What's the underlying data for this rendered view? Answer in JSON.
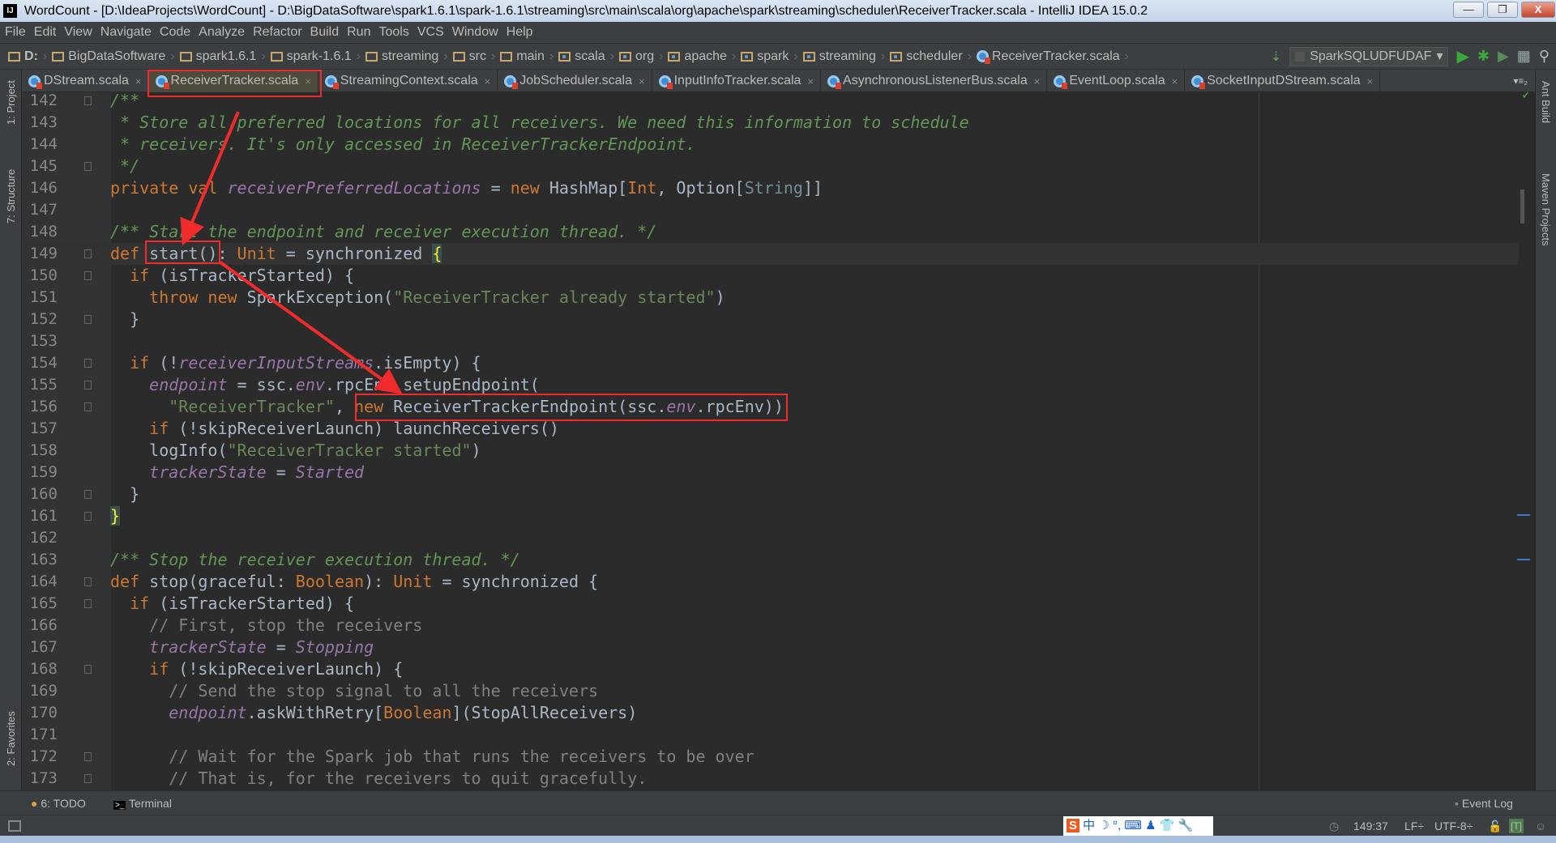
{
  "window": {
    "title": "WordCount - [D:\\IdeaProjects\\WordCount] - D:\\BigDataSoftware\\spark1.6.1\\spark-1.6.1\\streaming\\src\\main\\scala\\org\\apache\\spark\\streaming\\scheduler\\ReceiverTracker.scala - IntelliJ IDEA 15.0.2",
    "app_icon": "IJ",
    "minimize": "—",
    "restore": "❐",
    "close": "X"
  },
  "menu": [
    "File",
    "Edit",
    "View",
    "Navigate",
    "Code",
    "Analyze",
    "Refactor",
    "Build",
    "Run",
    "Tools",
    "VCS",
    "Window",
    "Help"
  ],
  "breadcrumb": [
    {
      "label": "D:",
      "type": "folder"
    },
    {
      "label": "BigDataSoftware",
      "type": "folder"
    },
    {
      "label": "spark1.6.1",
      "type": "folder"
    },
    {
      "label": "spark-1.6.1",
      "type": "folder"
    },
    {
      "label": "streaming",
      "type": "folder"
    },
    {
      "label": "src",
      "type": "folder"
    },
    {
      "label": "main",
      "type": "folder"
    },
    {
      "label": "scala",
      "type": "package"
    },
    {
      "label": "org",
      "type": "package"
    },
    {
      "label": "apache",
      "type": "package"
    },
    {
      "label": "spark",
      "type": "package"
    },
    {
      "label": "streaming",
      "type": "package"
    },
    {
      "label": "scheduler",
      "type": "package"
    },
    {
      "label": "ReceiverTracker.scala",
      "type": "scala-file"
    }
  ],
  "run_config": "SparkSQLUDFUDAF",
  "tabs": [
    {
      "label": "DStream.scala",
      "active": false
    },
    {
      "label": "ReceiverTracker.scala",
      "active": true
    },
    {
      "label": "StreamingContext.scala",
      "active": false
    },
    {
      "label": "JobScheduler.scala",
      "active": false
    },
    {
      "label": "InputInfoTracker.scala",
      "active": false
    },
    {
      "label": "AsynchronousListenerBus.scala",
      "active": false
    },
    {
      "label": "EventLoop.scala",
      "active": false
    },
    {
      "label": "SocketInputDStream.scala",
      "active": false
    }
  ],
  "tab_close": "×",
  "tabs_overflow": "▾≡₂",
  "left_stripe": {
    "project": "1: Project",
    "structure": "7: Structure",
    "favorites": "2: Favorites"
  },
  "right_stripe": {
    "ant": "Ant Build",
    "maven": "Maven Projects"
  },
  "editor": {
    "current_line": 149,
    "colors": {
      "keyword": "#cc7832",
      "string": "#6a8759",
      "doc_comment": "#629755",
      "field": "#9876aa",
      "text": "#a9b7c6",
      "background": "#2b2b2b"
    },
    "lines": [
      {
        "n": "142",
        "fold": true,
        "tokens": [
          [
            "d",
            "/**"
          ]
        ]
      },
      {
        "n": "143",
        "tokens": [
          [
            "d",
            " * Store all preferred locations for all receivers. We need this information to schedule"
          ]
        ]
      },
      {
        "n": "144",
        "tokens": [
          [
            "d",
            " * receivers. It's only accessed in ReceiverTrackerEndpoint."
          ]
        ]
      },
      {
        "n": "145",
        "fold": true,
        "tokens": [
          [
            "d",
            " */"
          ]
        ]
      },
      {
        "n": "146",
        "tokens": [
          [
            "k",
            "private val "
          ],
          [
            "f",
            "receiverPreferredLocations"
          ],
          [
            "p",
            " = "
          ],
          [
            "k",
            "new "
          ],
          [
            "p",
            "HashMap["
          ],
          [
            "t",
            "Int"
          ],
          [
            "p",
            ", Option["
          ],
          [
            "t2",
            "String"
          ],
          [
            "p",
            "]]"
          ]
        ]
      },
      {
        "n": "147",
        "tokens": []
      },
      {
        "n": "148",
        "tokens": [
          [
            "d",
            "/** Start the endpoint and receiver execution thread. */"
          ]
        ]
      },
      {
        "n": "149",
        "fold": true,
        "tokens": [
          [
            "k",
            "def "
          ],
          [
            "p",
            "start(): "
          ],
          [
            "t",
            "Unit"
          ],
          [
            "p",
            " = synchronized "
          ],
          [
            "b",
            "{"
          ]
        ]
      },
      {
        "n": "150",
        "fold": true,
        "tokens": [
          [
            "p",
            "  "
          ],
          [
            "k",
            "if"
          ],
          [
            "p",
            " (isTrackerStarted) {"
          ]
        ]
      },
      {
        "n": "151",
        "tokens": [
          [
            "p",
            "    "
          ],
          [
            "k",
            "throw new"
          ],
          [
            "p",
            " SparkException("
          ],
          [
            "s",
            "\"ReceiverTracker already started\""
          ],
          [
            "p",
            ")"
          ]
        ]
      },
      {
        "n": "152",
        "fold": true,
        "tokens": [
          [
            "p",
            "  }"
          ]
        ]
      },
      {
        "n": "153",
        "tokens": []
      },
      {
        "n": "154",
        "fold": true,
        "tokens": [
          [
            "p",
            "  "
          ],
          [
            "k",
            "if"
          ],
          [
            "p",
            " (!"
          ],
          [
            "f",
            "receiverInputStreams"
          ],
          [
            "p",
            ".isEmpty) {"
          ]
        ]
      },
      {
        "n": "155",
        "fold": true,
        "tokens": [
          [
            "p",
            "    "
          ],
          [
            "f",
            "endpoint"
          ],
          [
            "p",
            " = ssc."
          ],
          [
            "f",
            "env"
          ],
          [
            "p",
            ".rpcEnv.setupEndpoint("
          ]
        ]
      },
      {
        "n": "156",
        "fold": true,
        "tokens": [
          [
            "p",
            "      "
          ],
          [
            "s",
            "\"ReceiverTracker\""
          ],
          [
            "p",
            ", "
          ],
          [
            "k",
            "new"
          ],
          [
            "p",
            " ReceiverTrackerEndpoint(ssc."
          ],
          [
            "f",
            "env"
          ],
          [
            "p",
            ".rpcEnv))"
          ]
        ]
      },
      {
        "n": "157",
        "tokens": [
          [
            "p",
            "    "
          ],
          [
            "k",
            "if"
          ],
          [
            "p",
            " (!skipReceiverLaunch) launchReceivers()"
          ]
        ]
      },
      {
        "n": "158",
        "tokens": [
          [
            "p",
            "    logInfo("
          ],
          [
            "s",
            "\"ReceiverTracker started\""
          ],
          [
            "p",
            ")"
          ]
        ]
      },
      {
        "n": "159",
        "tokens": [
          [
            "p",
            "    "
          ],
          [
            "f",
            "trackerState"
          ],
          [
            "p",
            " = "
          ],
          [
            "f",
            "Started"
          ]
        ]
      },
      {
        "n": "160",
        "fold": true,
        "tokens": [
          [
            "p",
            "  }"
          ]
        ]
      },
      {
        "n": "161",
        "fold": true,
        "tokens": [
          [
            "b",
            "}"
          ]
        ]
      },
      {
        "n": "162",
        "tokens": []
      },
      {
        "n": "163",
        "tokens": [
          [
            "d",
            "/** Stop the receiver execution thread. */"
          ]
        ]
      },
      {
        "n": "164",
        "fold": true,
        "tokens": [
          [
            "k",
            "def "
          ],
          [
            "p",
            "stop(graceful: "
          ],
          [
            "t",
            "Boolean"
          ],
          [
            "p",
            "): "
          ],
          [
            "t",
            "Unit"
          ],
          [
            "p",
            " = synchronized {"
          ]
        ]
      },
      {
        "n": "165",
        "fold": true,
        "tokens": [
          [
            "p",
            "  "
          ],
          [
            "k",
            "if"
          ],
          [
            "p",
            " (isTrackerStarted) {"
          ]
        ]
      },
      {
        "n": "166",
        "tokens": [
          [
            "p",
            "    "
          ],
          [
            "c",
            "// First, stop the receivers"
          ]
        ]
      },
      {
        "n": "167",
        "tokens": [
          [
            "p",
            "    "
          ],
          [
            "f",
            "trackerState"
          ],
          [
            "p",
            " = "
          ],
          [
            "f",
            "Stopping"
          ]
        ]
      },
      {
        "n": "168",
        "fold": true,
        "tokens": [
          [
            "p",
            "    "
          ],
          [
            "k",
            "if"
          ],
          [
            "p",
            " (!skipReceiverLaunch) {"
          ]
        ]
      },
      {
        "n": "169",
        "tokens": [
          [
            "p",
            "      "
          ],
          [
            "c",
            "// Send the stop signal to all the receivers"
          ]
        ]
      },
      {
        "n": "170",
        "tokens": [
          [
            "p",
            "      "
          ],
          [
            "f",
            "endpoint"
          ],
          [
            "p",
            ".askWithRetry["
          ],
          [
            "t",
            "Boolean"
          ],
          [
            "p",
            "](StopAllReceivers)"
          ]
        ]
      },
      {
        "n": "171",
        "tokens": []
      },
      {
        "n": "172",
        "fold": true,
        "tokens": [
          [
            "p",
            "      "
          ],
          [
            "c",
            "// Wait for the Spark job that runs the receivers to be over"
          ]
        ]
      },
      {
        "n": "173",
        "fold": true,
        "tokens": [
          [
            "p",
            "      "
          ],
          [
            "c",
            "// That is, for the receivers to quit gracefully."
          ]
        ]
      }
    ]
  },
  "bottom_tools": {
    "todo": "6: TODO",
    "terminal": "Terminal",
    "event_log": "Event Log"
  },
  "status": {
    "position": "149:37",
    "line_sep": "LF÷",
    "encoding": "UTF-8÷"
  },
  "annotation_color": "#f02b2b"
}
